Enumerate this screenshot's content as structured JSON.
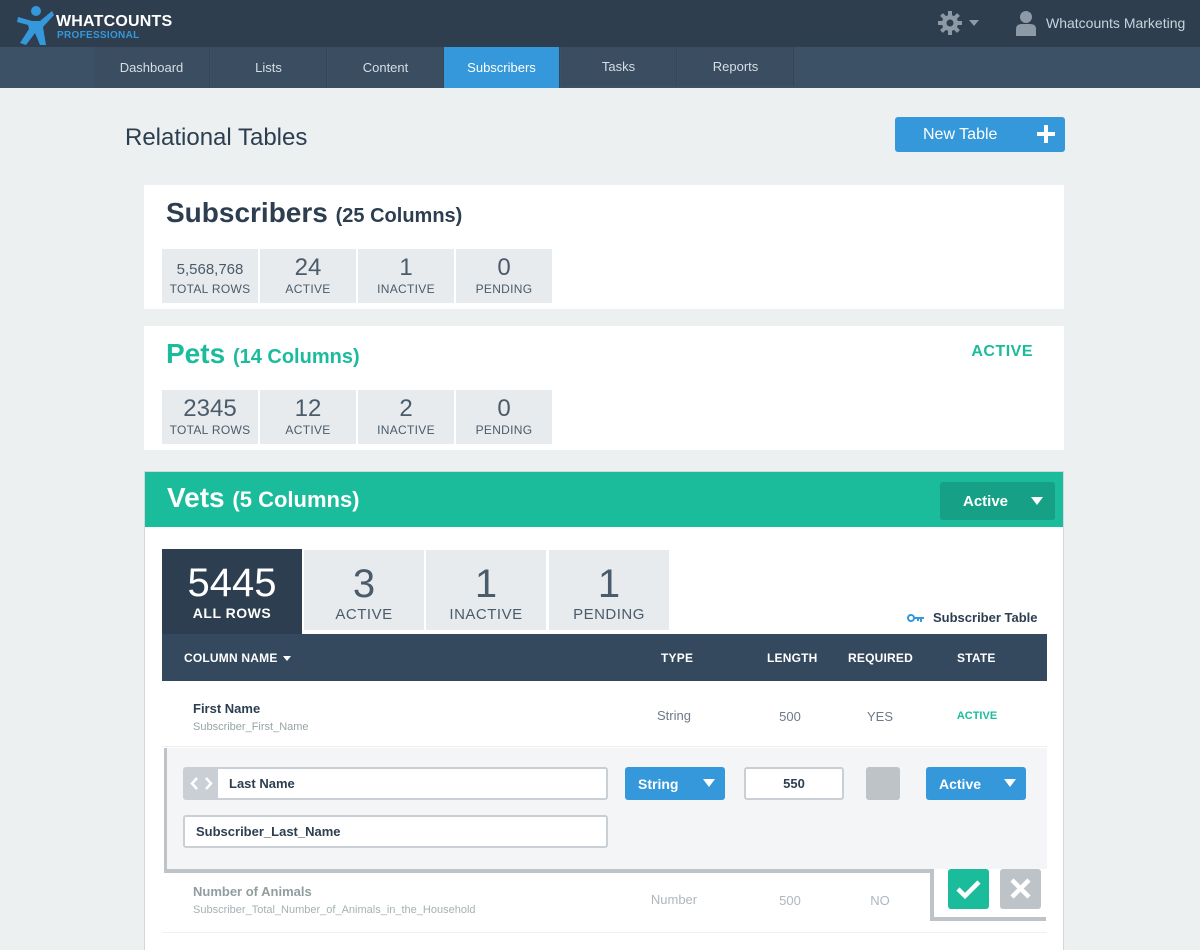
{
  "app": {
    "logo_word": "WHATCOUNTS",
    "logo_sub": "PROFESSIONAL",
    "settings_icon": "gear-icon",
    "user_icon": "user-icon",
    "user_name": "Whatcounts Marketing"
  },
  "nav": {
    "tabs": [
      {
        "label": "Dashboard",
        "active": false
      },
      {
        "label": "Lists",
        "active": false
      },
      {
        "label": "Content",
        "active": false
      },
      {
        "label": "Subscribers",
        "active": true
      },
      {
        "label": "Tasks",
        "active": false
      },
      {
        "label": "Reports",
        "active": false
      }
    ]
  },
  "page": {
    "title": "Relational Tables",
    "new_table_label": "New Table"
  },
  "tables": [
    {
      "name": "Subscribers",
      "columns": "(25 Columns)",
      "state": "",
      "stats": [
        {
          "value": "5,568,768",
          "label": "TOTAL ROWS"
        },
        {
          "value": "24",
          "label": "ACTIVE"
        },
        {
          "value": "1",
          "label": "INACTIVE"
        },
        {
          "value": "0",
          "label": "PENDING"
        }
      ]
    },
    {
      "name": "Pets",
      "columns": "(14 Columns)",
      "state": "ACTIVE",
      "stats": [
        {
          "value": "2345",
          "label": "TOTAL ROWS"
        },
        {
          "value": "12",
          "label": "ACTIVE"
        },
        {
          "value": "2",
          "label": "INACTIVE"
        },
        {
          "value": "0",
          "label": "PENDING"
        }
      ]
    }
  ],
  "vets": {
    "name": "Vets",
    "columns": "(5 Columns)",
    "state_select": "Active",
    "stats": [
      {
        "value": "5445",
        "label": "ALL ROWS"
      },
      {
        "value": "3",
        "label": "ACTIVE"
      },
      {
        "value": "1",
        "label": "INACTIVE"
      },
      {
        "value": "1",
        "label": "PENDING"
      }
    ],
    "key_legend": "Subscriber Table",
    "headers": {
      "column_name": "COLUMN NAME",
      "type": "TYPE",
      "length": "LENGTH",
      "required": "REQUIRED",
      "state": "STATE"
    },
    "rows": [
      {
        "name": "First Name",
        "field": "Subscriber_First_Name",
        "type": "String",
        "length": "500",
        "required": "YES",
        "state": "ACTIVE"
      },
      {
        "name": "Number of Animals",
        "field": "Subscriber_Total_Number_of_Animals_in_the_Household",
        "type": "Number",
        "length": "500",
        "required": "NO",
        "state": ""
      }
    ],
    "edit": {
      "name_value": "Last Name",
      "field_value": "Subscriber_Last_Name",
      "type_value": "String",
      "length_value": "550",
      "state_value": "Active"
    },
    "colors": {
      "teal": "#1abc9c",
      "blue": "#3498db",
      "navy": "#2c3e50"
    }
  }
}
